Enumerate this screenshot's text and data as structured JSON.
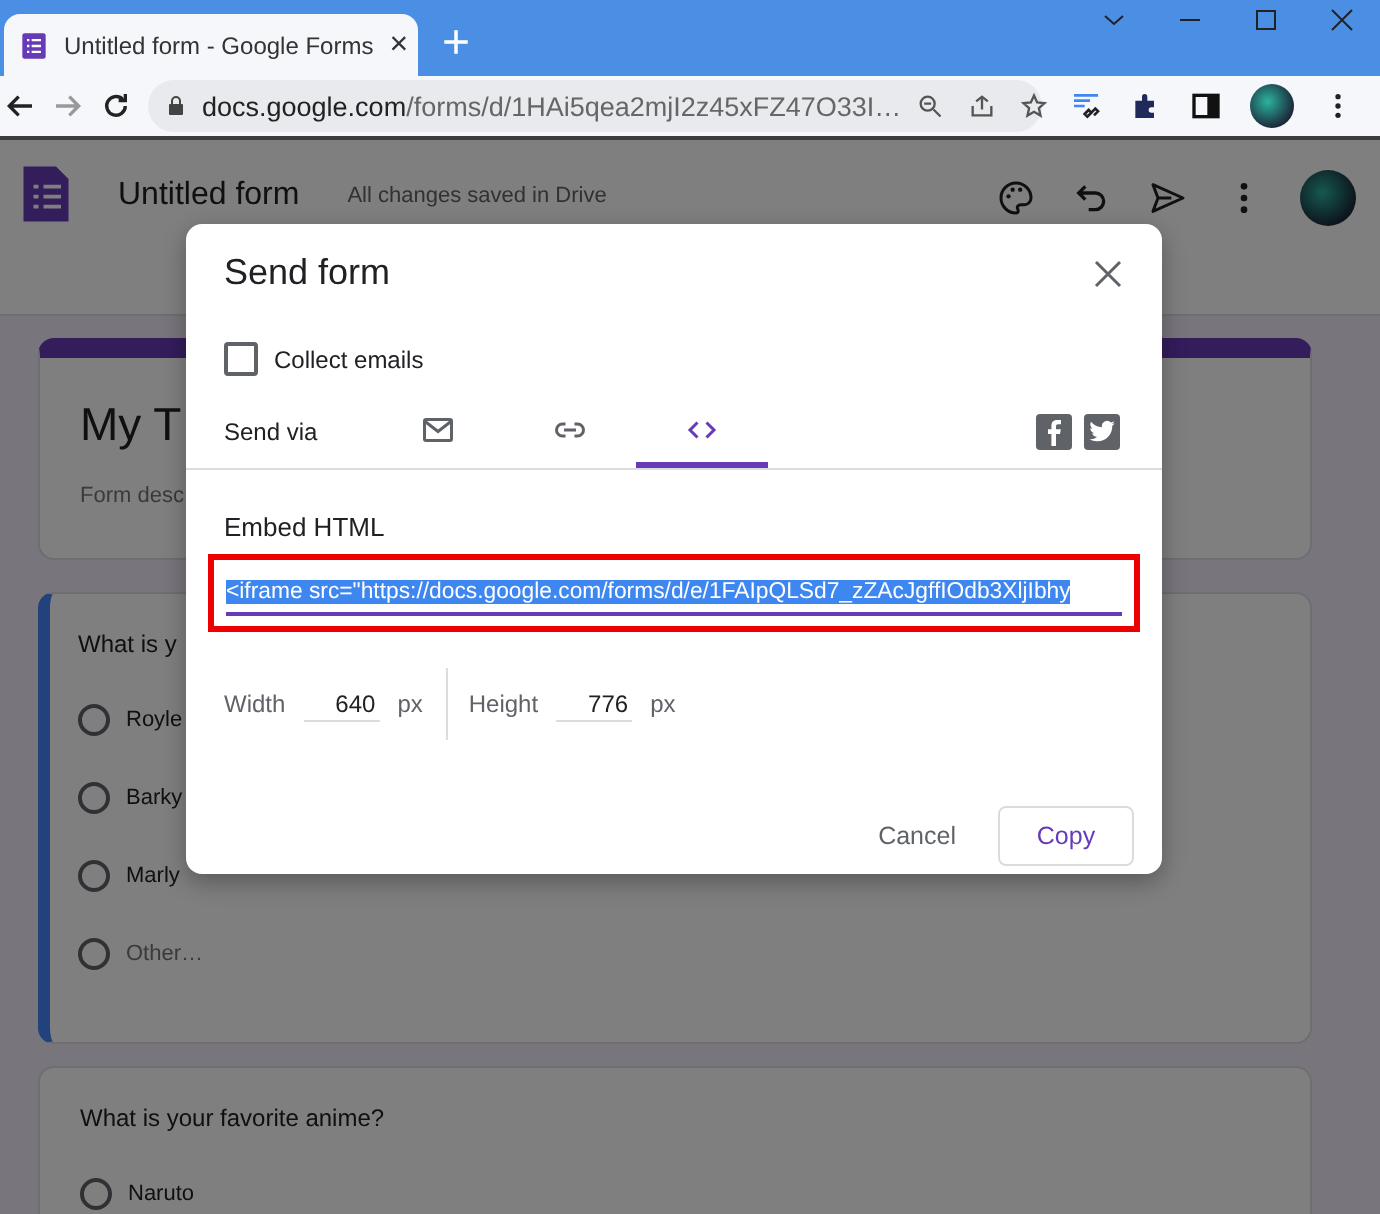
{
  "browser": {
    "tab": {
      "title": "Untitled form - Google Forms",
      "close": "×"
    },
    "new_tab": "+",
    "address": {
      "host": "docs.google.com",
      "path": "/forms/d/1HAi5qea2mjI2z45xFZ47O33I…"
    }
  },
  "header": {
    "title": "Untitled form",
    "save_status": "All changes saved in Drive"
  },
  "form": {
    "title": "My T",
    "description": "Form desc",
    "questions": [
      {
        "title": "What is y",
        "selected": true,
        "options": [
          {
            "label": "Royle",
            "kind": "choice"
          },
          {
            "label": "Barky",
            "kind": "choice"
          },
          {
            "label": "Marly",
            "kind": "choice"
          },
          {
            "label": "Other…",
            "kind": "other"
          }
        ]
      },
      {
        "title": "What is your favorite anime?",
        "selected": false,
        "options": [
          {
            "label": "Naruto",
            "kind": "choice"
          }
        ]
      }
    ]
  },
  "dialog": {
    "title": "Send form",
    "collect_emails": {
      "label": "Collect emails",
      "checked": false
    },
    "send_via": {
      "label": "Send via",
      "methods": [
        {
          "kind": "email",
          "selected": false
        },
        {
          "kind": "link",
          "selected": false
        },
        {
          "kind": "embed",
          "selected": true
        }
      ]
    },
    "section_title": "Embed HTML",
    "embed_code": {
      "value": "<iframe src=\"https://docs.google.com/forms/d/e/1FAIpQLSd7_zZAcJgffIOdb3XljIbhy",
      "selected": true
    },
    "size_fields": [
      {
        "label": "Width",
        "value": "640",
        "unit": "px"
      },
      {
        "label": "Height",
        "value": "776",
        "unit": "px"
      }
    ],
    "buttons": [
      {
        "label": "Cancel",
        "kind": "text"
      },
      {
        "label": "Copy",
        "kind": "outlined"
      }
    ]
  }
}
